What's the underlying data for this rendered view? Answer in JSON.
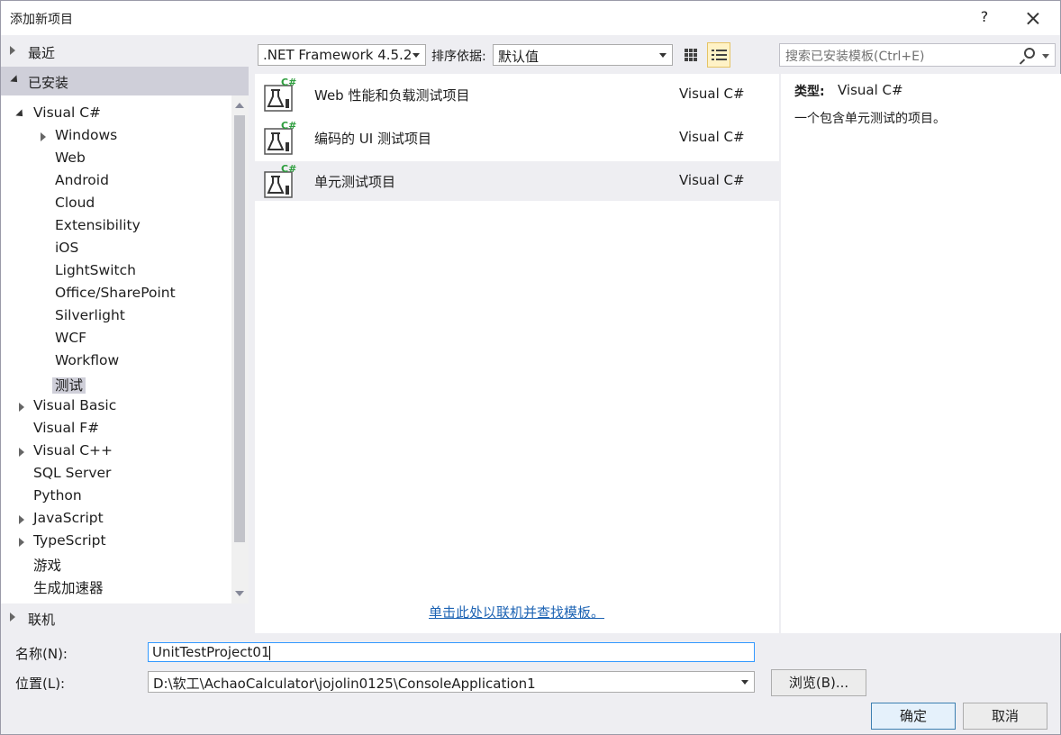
{
  "window": {
    "title": "添加新项目",
    "help_label": "?"
  },
  "left": {
    "recent": "最近",
    "installed": "已安装",
    "online": "联机",
    "tree": [
      {
        "label": "Visual C#",
        "level": 0,
        "arrow": "expanded"
      },
      {
        "label": "Windows",
        "level": 1,
        "arrow": "collapsed"
      },
      {
        "label": "Web",
        "level": 1,
        "arrow": "none"
      },
      {
        "label": "Android",
        "level": 1,
        "arrow": "none"
      },
      {
        "label": "Cloud",
        "level": 1,
        "arrow": "none"
      },
      {
        "label": "Extensibility",
        "level": 1,
        "arrow": "none"
      },
      {
        "label": "iOS",
        "level": 1,
        "arrow": "none"
      },
      {
        "label": "LightSwitch",
        "level": 1,
        "arrow": "none"
      },
      {
        "label": "Office/SharePoint",
        "level": 1,
        "arrow": "none"
      },
      {
        "label": "Silverlight",
        "level": 1,
        "arrow": "none"
      },
      {
        "label": "WCF",
        "level": 1,
        "arrow": "none"
      },
      {
        "label": "Workflow",
        "level": 1,
        "arrow": "none"
      },
      {
        "label": "测试",
        "level": 1,
        "arrow": "none",
        "selected": true
      },
      {
        "label": "Visual Basic",
        "level": 0,
        "arrow": "collapsed"
      },
      {
        "label": "Visual F#",
        "level": 0,
        "arrow": "none"
      },
      {
        "label": "Visual C++",
        "level": 0,
        "arrow": "collapsed"
      },
      {
        "label": "SQL Server",
        "level": 0,
        "arrow": "none"
      },
      {
        "label": "Python",
        "level": 0,
        "arrow": "none"
      },
      {
        "label": "JavaScript",
        "level": 0,
        "arrow": "collapsed"
      },
      {
        "label": "TypeScript",
        "level": 0,
        "arrow": "collapsed"
      },
      {
        "label": "游戏",
        "level": 0,
        "arrow": "none"
      },
      {
        "label": "生成加速器",
        "level": 0,
        "arrow": "none"
      }
    ]
  },
  "toolbar": {
    "framework": ".NET Framework 4.5.2",
    "sort_label": "排序依据:",
    "sort_value": "默认值",
    "search_placeholder": "搜索已安装模板(Ctrl+E)"
  },
  "templates": [
    {
      "name": "Web 性能和负载测试项目",
      "lang": "Visual C#",
      "selected": false
    },
    {
      "name": "编码的 UI 测试项目",
      "lang": "Visual C#",
      "selected": false
    },
    {
      "name": "单元测试项目",
      "lang": "Visual C#",
      "selected": true
    }
  ],
  "online_link": "单击此处以联机并查找模板。",
  "description": {
    "type_label": "类型:",
    "type_value": "Visual C#",
    "text": "一个包含单元测试的项目。"
  },
  "form": {
    "name_label": "名称(N):",
    "name_value": "UnitTestProject01",
    "location_label": "位置(L):",
    "location_value": "D:\\软工\\AchaoCalculator\\jojolin0125\\ConsoleApplication1",
    "browse_label": "浏览(B)...",
    "ok_label": "确定",
    "cancel_label": "取消"
  },
  "colors": {
    "accent": "#3399ff",
    "selection": "#cfcfd9",
    "link": "#1e64b4",
    "cs_badge": "#2e9e3e"
  }
}
